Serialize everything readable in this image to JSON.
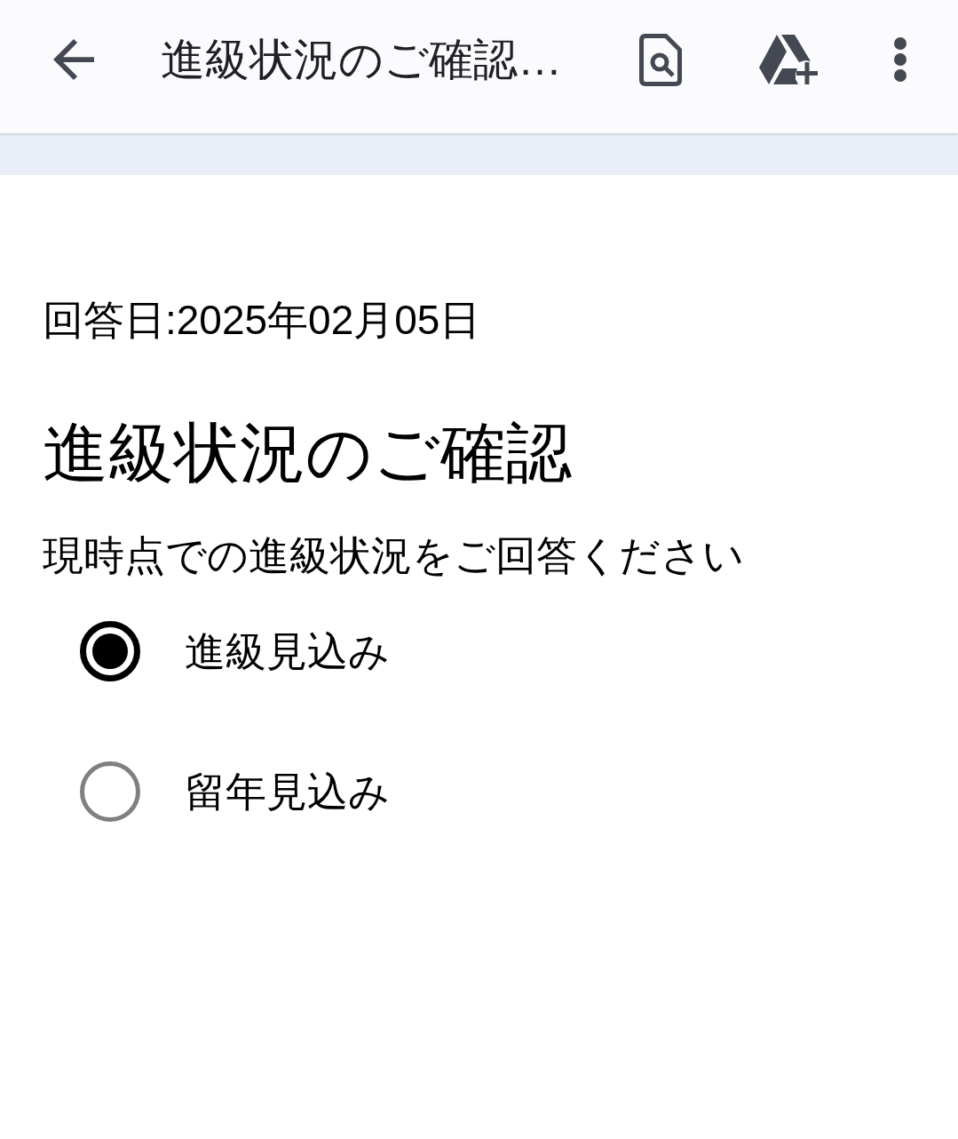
{
  "app_bar": {
    "title": "進級状況のご確認…"
  },
  "form": {
    "answer_date": "回答日:2025年02月05日",
    "title": "進級状況のご確認",
    "question": "現時点での進級状況をご回答ください",
    "options": [
      {
        "label": "進級見込み",
        "selected": true
      },
      {
        "label": "留年見込み",
        "selected": false
      }
    ]
  }
}
